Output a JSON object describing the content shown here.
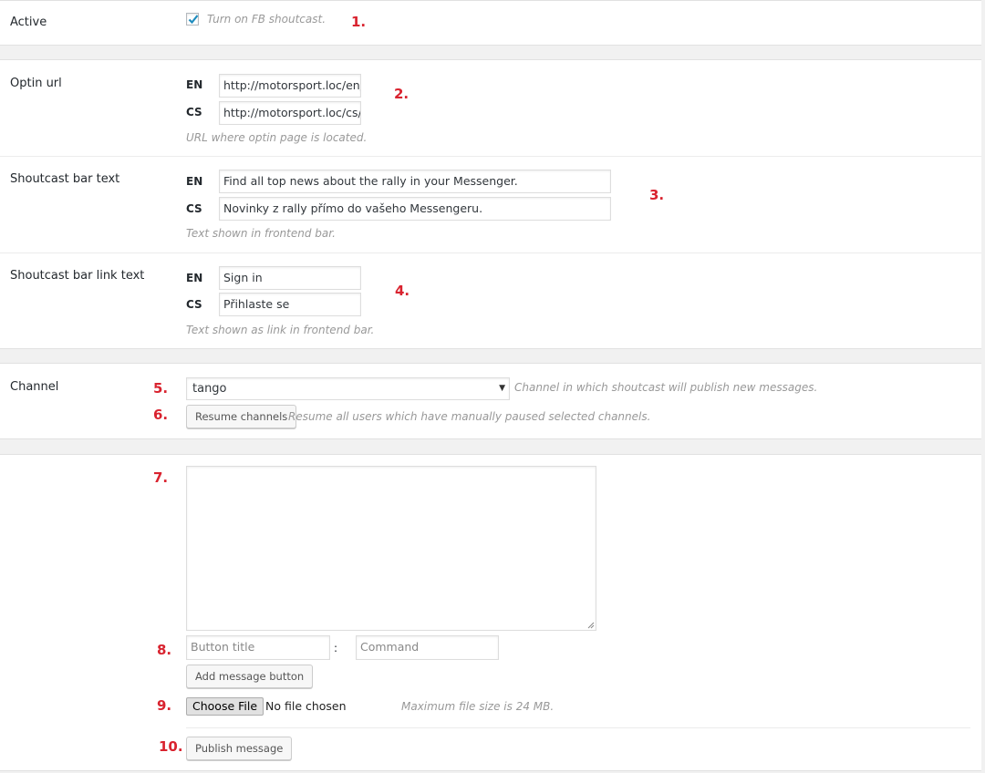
{
  "active": {
    "label": "Active",
    "checked": true,
    "checkbox_text": "Turn on FB shoutcast.",
    "marker": "1."
  },
  "optin_url": {
    "label": "Optin url",
    "lang_en": "EN",
    "lang_cs": "CS",
    "value_en": "http://motorsport.loc/en/s",
    "value_cs": "http://motorsport.loc/cs/sl",
    "description": "URL where optin page is located.",
    "marker": "2."
  },
  "bar_text": {
    "label": "Shoutcast bar text",
    "lang_en": "EN",
    "lang_cs": "CS",
    "value_en": "Find all top news about the rally in your Messenger.",
    "value_cs": "Novinky z rally přímo do vašeho Messengeru.",
    "description": "Text shown in frontend bar.",
    "marker": "3."
  },
  "bar_link_text": {
    "label": "Shoutcast bar link text",
    "lang_en": "EN",
    "lang_cs": "CS",
    "value_en": "Sign in",
    "value_cs": "Přihlaste se",
    "description": "Text shown as link in frontend bar.",
    "marker": "4."
  },
  "channel": {
    "label": "Channel",
    "selected": "tango",
    "description": "Channel in which shoutcast will publish new messages.",
    "marker": "5.",
    "resume_button": "Resume channels",
    "resume_description": "Resume all users which have manually paused selected channels.",
    "resume_marker": "6."
  },
  "message": {
    "textarea_marker": "7.",
    "textarea_value": "",
    "button_title_placeholder": "Button title",
    "separator": ":",
    "command_placeholder": "Command",
    "buttons_marker": "8.",
    "add_button": "Add message button",
    "file_marker": "9.",
    "choose_file": "Choose File",
    "no_file": "No file chosen",
    "max_size": "Maximum file size is 24 MB.",
    "publish_marker": "10.",
    "publish_button": "Publish message"
  },
  "colors": {
    "marker": "#d9232f",
    "checkmark": "#1e8cbe",
    "background": "#f1f1f1"
  },
  "icons": {
    "checkbox": "checkmark-icon",
    "select": "dropdown-arrow-icon",
    "textarea": "resize-grip-icon"
  }
}
